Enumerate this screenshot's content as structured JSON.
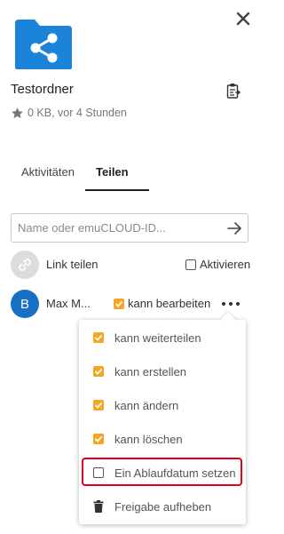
{
  "header": {
    "close_icon": "close-icon",
    "folder_icon": "shared-folder-icon",
    "folder_color": "#1b84d8",
    "folder_name": "Testordner",
    "clipboard_icon": "clipboard-icon",
    "meta": "0 KB, vor 4 Stunden",
    "star_icon": "star-icon"
  },
  "tabs": [
    {
      "label": "Aktivitäten",
      "active": false
    },
    {
      "label": "Teilen",
      "active": true
    }
  ],
  "share": {
    "placeholder": "Name oder emuCLOUD-ID...",
    "value": "",
    "submit_icon": "arrow-right-icon"
  },
  "link_share": {
    "icon": "link-icon",
    "label": "Link teilen",
    "activate_label": "Aktivieren",
    "activate_checked": false
  },
  "user_share": {
    "avatar_initial": "B",
    "avatar_color": "#1670c4",
    "name": "Max M...",
    "can_edit_label": "kann bearbeiten",
    "can_edit_checked": true,
    "more_icon": "more-options-icon"
  },
  "menu": {
    "items": [
      {
        "label": "kann weiterteilen",
        "checked": true
      },
      {
        "label": "kann erstellen",
        "checked": true
      },
      {
        "label": "kann ändern",
        "checked": true
      },
      {
        "label": "kann löschen",
        "checked": true
      },
      {
        "label": "Ein Ablaufdatum setzen",
        "checked": false,
        "highlighted": true
      },
      {
        "label": "Freigabe aufheben",
        "icon": "trash-icon"
      }
    ],
    "checked_color": "#f5a623",
    "highlight_color": "#e0001b"
  }
}
